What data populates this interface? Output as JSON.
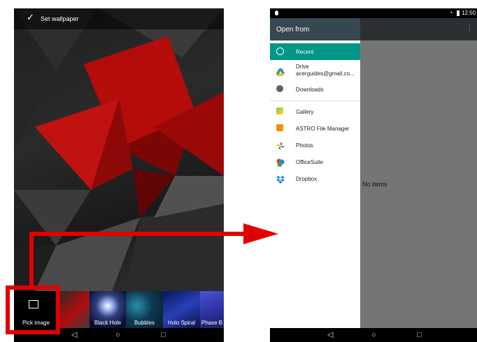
{
  "left_screen": {
    "topbar": {
      "set_wallpaper": "Set wallpaper"
    },
    "thumbnails": [
      {
        "label": "Pick image"
      },
      {
        "label": ""
      },
      {
        "label": "Black Hole"
      },
      {
        "label": "Bubbles"
      },
      {
        "label": "Holo Spiral"
      },
      {
        "label": "Phase B"
      }
    ],
    "nav": {
      "back": "◁",
      "home": "○",
      "recent": "□"
    }
  },
  "right_screen": {
    "status": {
      "time": "12:50"
    },
    "drawer": {
      "title": "Open from",
      "items": [
        {
          "label": "Recent",
          "icon": "clock-icon",
          "selected": true
        },
        {
          "label": "Drive",
          "sub": "acerguides@gmail.co...",
          "icon": "drive-icon"
        },
        {
          "label": "Downloads",
          "icon": "download-icon"
        },
        {
          "label": "Gallery",
          "icon": "gallery-icon"
        },
        {
          "label": "ASTRO File Manager",
          "icon": "astro-icon"
        },
        {
          "label": "Photos",
          "icon": "photos-icon"
        },
        {
          "label": "OfficeSuite",
          "icon": "officesuite-icon"
        },
        {
          "label": "Dropbox",
          "icon": "dropbox-icon"
        }
      ]
    },
    "content": {
      "empty_text": "No items"
    },
    "nav": {
      "back": "◁",
      "home": "○",
      "recent": "□"
    }
  },
  "colors": {
    "accent": "#009688",
    "annotation": "#e10000",
    "drawer_header": "#37474f"
  }
}
